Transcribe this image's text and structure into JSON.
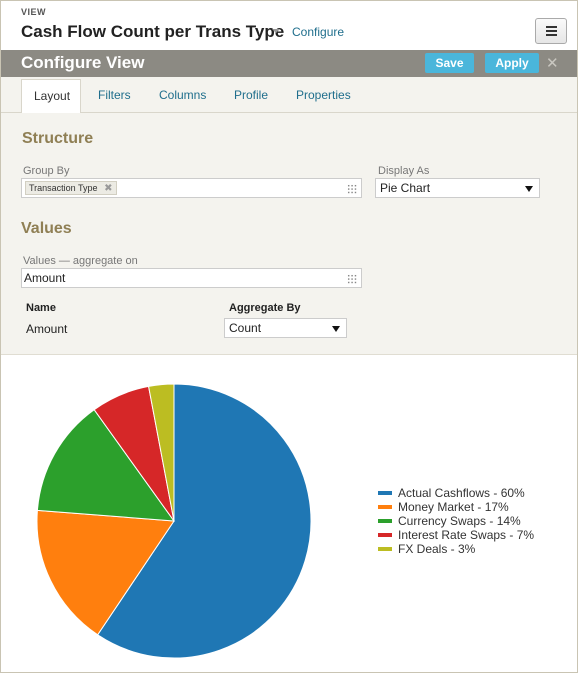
{
  "header": {
    "eyebrow": "VIEW",
    "title": "Cash Flow Count per Trans Type",
    "configure_link": "Configure",
    "menu_icon": "hamburger-icon"
  },
  "config_bar": {
    "title": "Configure View",
    "save_label": "Save",
    "apply_label": "Apply",
    "close_glyph": "✕"
  },
  "tabs": [
    {
      "label": "Layout",
      "active": true
    },
    {
      "label": "Filters"
    },
    {
      "label": "Columns"
    },
    {
      "label": "Profile"
    },
    {
      "label": "Properties"
    }
  ],
  "structure": {
    "heading": "Structure",
    "group_by_label": "Group By",
    "group_by_token": "Transaction Type",
    "display_as_label": "Display As",
    "display_as_value": "Pie Chart"
  },
  "values": {
    "heading": "Values",
    "values_label": "Values — aggregate on",
    "values_value": "Amount",
    "col_name": "Name",
    "col_aggregate": "Aggregate By",
    "row_name": "Amount",
    "row_aggregate": "Count"
  },
  "chart_data": {
    "type": "pie",
    "categories": [
      "Actual Cashflows",
      "Money Market",
      "Currency Swaps",
      "Interest Rate Swaps",
      "FX Deals"
    ],
    "values": [
      60,
      17,
      14,
      7,
      3
    ],
    "legend": [
      "Actual Cashflows - 60%",
      "Money Market - 17%",
      "Currency Swaps - 14%",
      "Interest Rate Swaps - 7%",
      "FX Deals - 3%"
    ],
    "colors": [
      "#1f77b4",
      "#ff7f0e",
      "#2ca02c",
      "#d62728",
      "#bcbd22"
    ],
    "legend_position": "right"
  }
}
